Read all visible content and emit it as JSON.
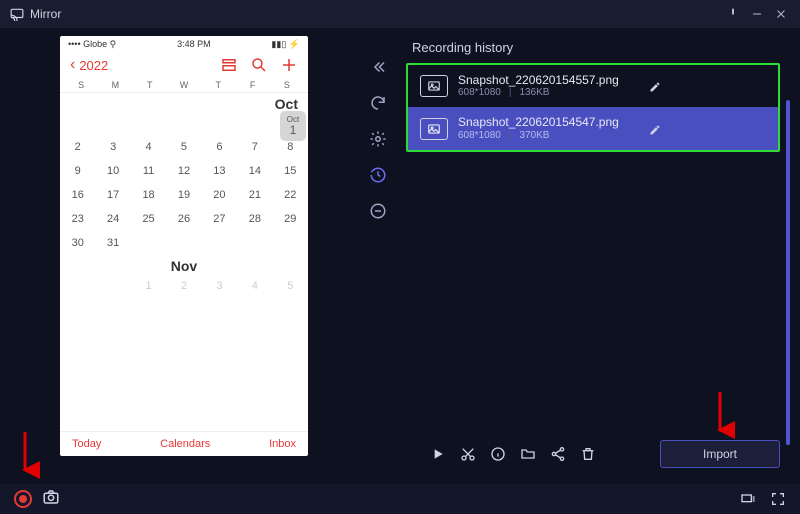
{
  "titlebar": {
    "app_name": "Mirror"
  },
  "phone": {
    "carrier": "Globe",
    "time": "3:48 PM",
    "year": "2022",
    "dow": [
      "S",
      "M",
      "T",
      "W",
      "T",
      "F",
      "S"
    ],
    "month_label_oct": "Oct",
    "month_label_nov": "Nov",
    "oct_today_num": "1",
    "footer": {
      "today": "Today",
      "calendars": "Calendars",
      "inbox": "Inbox"
    }
  },
  "sidebar_tool_names": [
    "collapse",
    "refresh",
    "settings",
    "history",
    "remove"
  ],
  "history": {
    "title": "Recording history",
    "items": [
      {
        "name": "Snapshot_220620154557.png",
        "res": "608*1080",
        "size": "136KB",
        "selected": false
      },
      {
        "name": "Snapshot_220620154547.png",
        "res": "608*1080",
        "size": "370KB",
        "selected": true
      }
    ],
    "toolbar": [
      "play",
      "cut",
      "info",
      "folder",
      "share",
      "delete"
    ],
    "import_label": "Import"
  }
}
